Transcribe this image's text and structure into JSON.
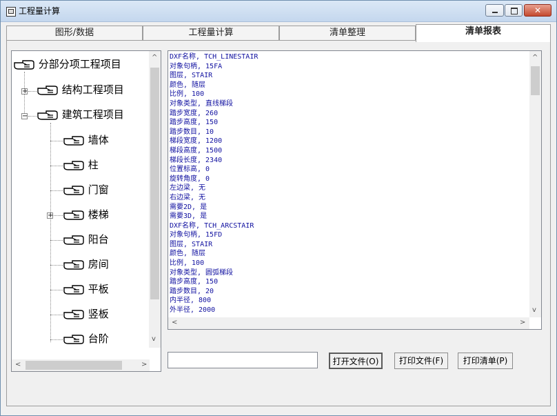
{
  "window": {
    "title": "工程量计算"
  },
  "tabs": [
    {
      "label": "图形/数据"
    },
    {
      "label": "工程量计算"
    },
    {
      "label": "清单整理"
    },
    {
      "label": "清单报表"
    }
  ],
  "tree": {
    "root": "分部分项工程项目",
    "groups": [
      {
        "label": "结构工程项目",
        "expanded": false
      },
      {
        "label": "建筑工程项目",
        "expanded": true
      }
    ],
    "children": [
      "墙体",
      "柱",
      "门窗",
      "楼梯",
      "阳台",
      "房间",
      "平板",
      "竖板",
      "台阶"
    ]
  },
  "text_lines": [
    "DXF名称, TCH_LINESTAIR",
    "对象句柄, 15FA",
    "图层, STAIR",
    "颜色, 随层",
    "比例, 100",
    "对象类型, 直线梯段",
    "踏步宽度, 260",
    "踏步高度, 150",
    "踏步数目, 10",
    "梯段宽度, 1200",
    "梯段高度, 1500",
    "梯段长度, 2340",
    "位置标高, 0",
    "旋转角度, 0",
    "左边梁, 无",
    "右边梁, 无",
    "需要2D, 是",
    "需要3D, 是",
    "DXF名称, TCH_ARCSTAIR",
    "对象句柄, 15FD",
    "图层, STAIR",
    "颜色, 随层",
    "比例, 100",
    "对象类型, 圆弧梯段",
    "踏步高度, 150",
    "踏步数目, 20",
    "内半径, 800",
    "外半径, 2000"
  ],
  "buttons": {
    "open_file": "打开文件(O)",
    "print_file": "打印文件(F)",
    "print_list": "打印清单(P)"
  },
  "filename_input": {
    "value": ""
  }
}
